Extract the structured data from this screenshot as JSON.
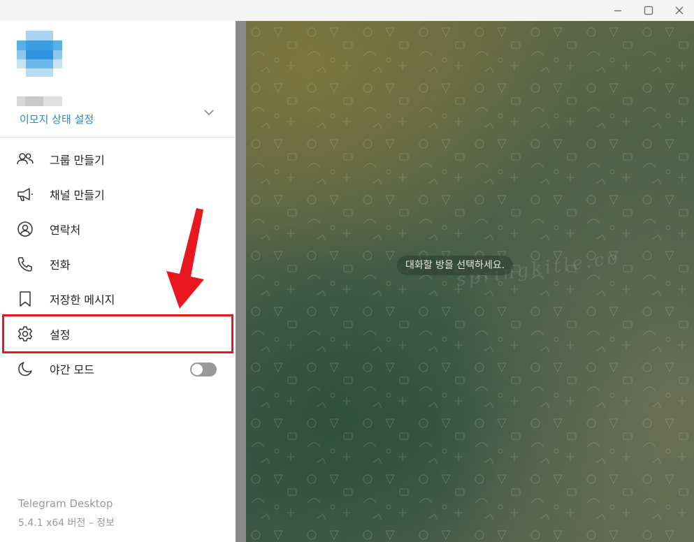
{
  "window": {
    "controls": [
      "minimize",
      "maximize",
      "close"
    ]
  },
  "sidebar": {
    "emoji_status_label": "이모지 상태 설정",
    "menu": [
      {
        "id": "new-group",
        "label": "그룹 만들기",
        "icon": "group-icon"
      },
      {
        "id": "new-channel",
        "label": "채널 만들기",
        "icon": "megaphone-icon"
      },
      {
        "id": "contacts",
        "label": "연락처",
        "icon": "contact-icon"
      },
      {
        "id": "calls",
        "label": "전화",
        "icon": "phone-icon"
      },
      {
        "id": "saved-messages",
        "label": "저장한 메시지",
        "icon": "bookmark-icon"
      },
      {
        "id": "settings",
        "label": "설정",
        "icon": "gear-icon"
      },
      {
        "id": "night-mode",
        "label": "야간 모드",
        "icon": "moon-icon"
      }
    ],
    "night_mode_enabled": false,
    "footer": {
      "app_name": "Telegram Desktop",
      "version_info": "5.4.1 x64 버전 – 정보"
    }
  },
  "chat": {
    "placeholder": "대화할 방을 선택하세요.",
    "watermark": "springkitle.co"
  },
  "colors": {
    "accent": "#2a8ac4",
    "highlight": "#e8171f",
    "toggle_off": "#999999"
  }
}
